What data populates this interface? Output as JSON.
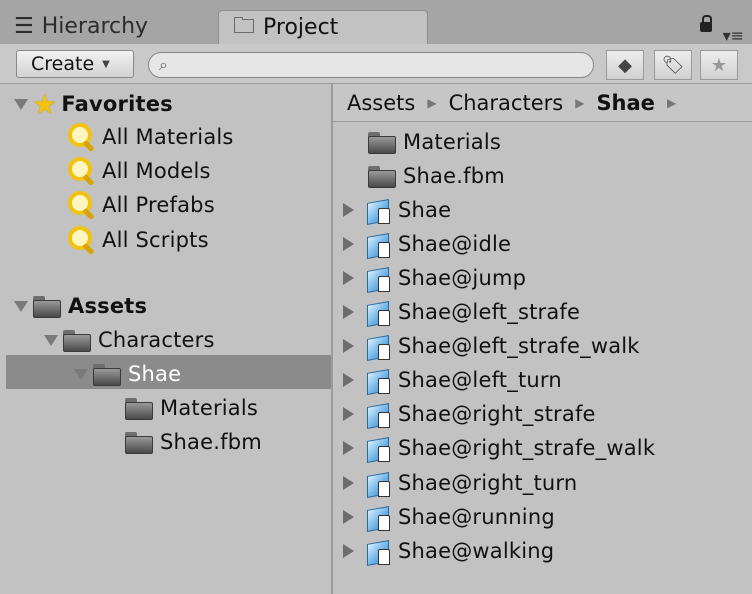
{
  "tabs": {
    "hierarchy": "Hierarchy",
    "project": "Project"
  },
  "icons": {
    "hierarchy": "list-icon",
    "project": "folder-icon",
    "lock": "lock-icon",
    "menu": "menu-icon",
    "search": "search-icon",
    "filter_type": "shapes-icon",
    "filter_label": "tag-icon",
    "favorite": "star-icon"
  },
  "toolbar": {
    "create_label": "Create",
    "search_placeholder": ""
  },
  "favorites": {
    "label": "Favorites",
    "items": [
      "All Materials",
      "All Models",
      "All Prefabs",
      "All Scripts"
    ]
  },
  "assets": {
    "label": "Assets",
    "characters": "Characters",
    "shae": "Shae",
    "children": [
      "Materials",
      "Shae.fbm"
    ]
  },
  "breadcrumb": {
    "items": [
      "Assets",
      "Characters",
      "Shae"
    ]
  },
  "files": {
    "folders": [
      "Materials",
      "Shae.fbm"
    ],
    "models": [
      "Shae",
      "Shae@idle",
      "Shae@jump",
      "Shae@left_strafe",
      "Shae@left_strafe_walk",
      "Shae@left_turn",
      "Shae@right_strafe",
      "Shae@right_strafe_walk",
      "Shae@right_turn",
      "Shae@running",
      "Shae@walking"
    ]
  }
}
